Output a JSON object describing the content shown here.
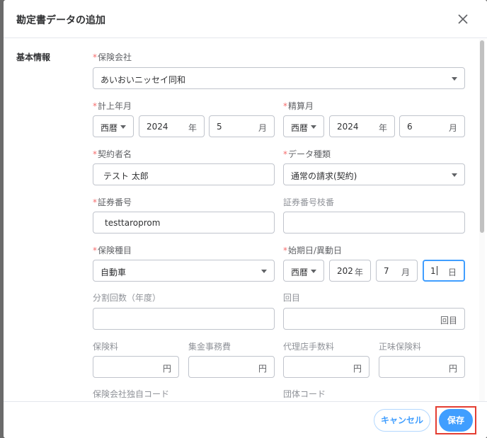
{
  "dialog": {
    "title": "勘定書データの追加",
    "close_icon": "close-icon"
  },
  "section": {
    "label": "基本情報"
  },
  "required_mark": "*",
  "fields": {
    "insurer": {
      "label": "保険会社",
      "value": "あいおいニッセイ同和"
    },
    "posting_ym": {
      "label": "計上年月",
      "era": "西暦",
      "year": "2024",
      "year_unit": "年",
      "month": "5",
      "month_unit": "月"
    },
    "settlement_month": {
      "label": "精算月",
      "era": "西暦",
      "year": "2024",
      "year_unit": "年",
      "month": "6",
      "month_unit": "月"
    },
    "contractor": {
      "label": "契約者名",
      "value": "テスト 太郎"
    },
    "data_type": {
      "label": "データ種類",
      "value": "通常の請求(契約)"
    },
    "policy_no": {
      "label": "証券番号",
      "value": "testtaroprom"
    },
    "policy_branch": {
      "label": "証券番号枝番",
      "value": ""
    },
    "insurance_type": {
      "label": "保険種目",
      "value": "自動車"
    },
    "start_date": {
      "label": "始期日/異動日",
      "era": "西暦",
      "year": "202",
      "year_unit": "年",
      "month": "7",
      "month_unit": "月",
      "day": "1",
      "day_unit": "日"
    },
    "installments": {
      "label": "分割回数（年度）",
      "value": ""
    },
    "count": {
      "label": "回目",
      "unit": "回目"
    },
    "premium": {
      "label": "保険料",
      "unit": "円"
    },
    "collection_fee": {
      "label": "集金事務費",
      "unit": "円"
    },
    "agency_fee": {
      "label": "代理店手数料",
      "unit": "円"
    },
    "net_premium": {
      "label": "正味保険料",
      "unit": "円"
    },
    "insurer_code": {
      "label": "保険会社独自コード"
    },
    "group_code": {
      "label": "団体コード"
    }
  },
  "footer": {
    "cancel_label": "キャンセル",
    "save_label": "保存"
  },
  "colors": {
    "accent": "#409eff",
    "required": "#f56c6c",
    "highlight": "#e43d32"
  }
}
